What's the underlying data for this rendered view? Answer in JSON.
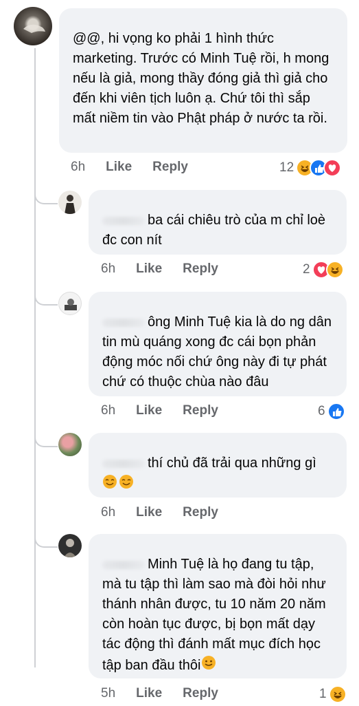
{
  "main_comment": {
    "text": "@@, hi vọng ko phải 1 hình thức marketing. Trước có Minh Tuệ rồi, h mong nếu là giả, mong thầy đóng giả thì giả cho đến khi viên tịch luôn ạ. Chứ tôi thì sắp mất niềm tin vào Phật pháp ở nước ta rồi.",
    "time": "6h",
    "like_label": "Like",
    "reply_label": "Reply",
    "reaction_count": "12",
    "reactions": [
      "haha",
      "like",
      "love"
    ]
  },
  "replies": [
    {
      "text": "ba cái chiêu trò của m chỉ loè đc con nít",
      "time": "6h",
      "like_label": "Like",
      "reply_label": "Reply",
      "reaction_count": "2",
      "reactions": [
        "love",
        "haha"
      ]
    },
    {
      "text": "ông Minh Tuệ kia là do ng dân tin mù quáng xong đc cái bọn phản động móc nối chứ ông này đi tự phát chứ có thuộc chùa nào đâu",
      "time": "6h",
      "like_label": "Like",
      "reply_label": "Reply",
      "reaction_count": "6",
      "reactions": [
        "like"
      ]
    },
    {
      "text": "thí chủ đã trải qua những gì",
      "time": "6h",
      "like_label": "Like",
      "reply_label": "Reply",
      "reaction_count": "",
      "reactions": []
    },
    {
      "text": "Minh Tuệ là họ đang tu tập, mà tu tập thì làm sao mà đòi hỏi như thánh nhân được, tu 10 năm 20 năm còn hoàn tục được, bị bọn mất dạy tác động thì đánh mất mục đích học tập ban đầu thôi",
      "time": "5h",
      "like_label": "Like",
      "reply_label": "Reply",
      "reaction_count": "1",
      "reactions": [
        "haha"
      ]
    }
  ],
  "colors": {
    "bubble": "#f0f2f5",
    "meta": "#65676b",
    "like_blue": "#1877f2",
    "love_red": "#f33e58",
    "haha_yellow": "#f7b125"
  }
}
